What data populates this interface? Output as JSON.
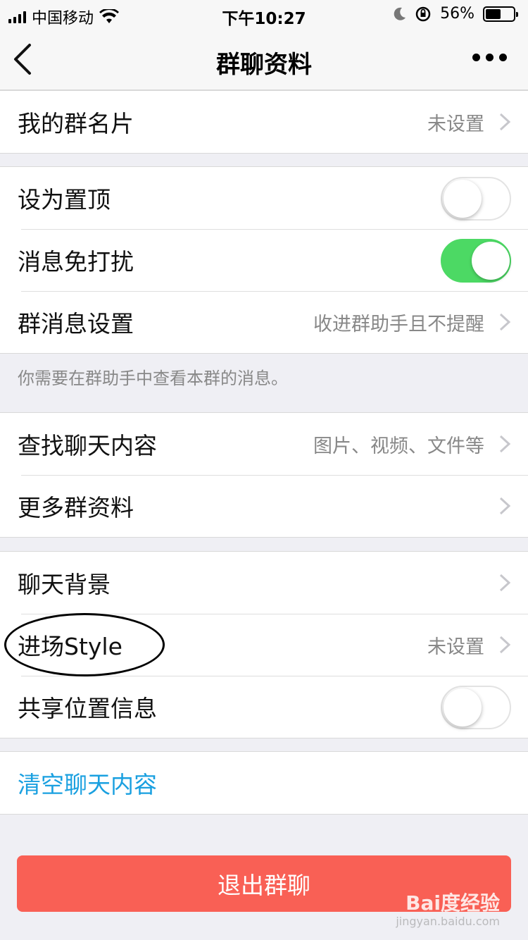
{
  "status_bar": {
    "carrier": "中国移动",
    "time": "下午10:27",
    "battery_percent": "56%",
    "battery_level": 0.56,
    "icons": [
      "signal-icon",
      "wifi-icon",
      "moon-icon",
      "orientation-lock-icon",
      "battery-icon"
    ]
  },
  "nav": {
    "title": "群聊资料",
    "back_icon": "chevron-left-icon",
    "more_icon": "more-icon"
  },
  "group1": {
    "my_card_label": "我的群名片",
    "my_card_value": "未设置"
  },
  "group2": {
    "pin_label": "设为置顶",
    "pin_on": false,
    "mute_label": "消息免打扰",
    "mute_on": true,
    "msg_settings_label": "群消息设置",
    "msg_settings_value": "收进群助手且不提醒"
  },
  "note": "你需要在群助手中查看本群的消息。",
  "group3": {
    "search_label": "查找聊天内容",
    "search_value": "图片、视频、文件等",
    "more_info_label": "更多群资料"
  },
  "group4": {
    "background_label": "聊天背景",
    "entry_style_label": "进场Style",
    "entry_style_value": "未设置",
    "share_location_label": "共享位置信息",
    "share_location_on": false
  },
  "group5": {
    "clear_label": "清空聊天内容"
  },
  "quit_button": "退出群聊",
  "colors": {
    "accent_blue": "#1aa0e0",
    "toggle_green": "#4cd964",
    "danger_red": "#f96055"
  },
  "watermark": {
    "logo": "Bai度经验",
    "url": "jingyan.baidu.com"
  }
}
